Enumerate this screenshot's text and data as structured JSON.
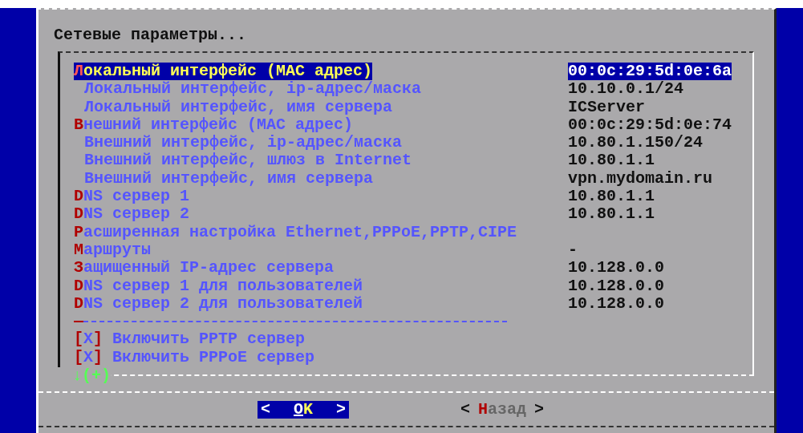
{
  "dialog": {
    "title": "Сетевые параметры...",
    "items": [
      {
        "kind": "main",
        "label": "Локальный интерфейс (MAC адрес)",
        "value": "00:0c:29:5d:0e:6a",
        "selected": true
      },
      {
        "kind": "sub",
        "label": "Локальный интерфейс, ip-адрес/маска",
        "value": "10.10.0.1/24",
        "selected": false
      },
      {
        "kind": "sub",
        "label": "Локальный интерфейс, имя сервера",
        "value": "ICServer",
        "selected": false
      },
      {
        "kind": "main",
        "label": "Внешний интерфейс (MAC адрес)",
        "value": "00:0c:29:5d:0e:74",
        "selected": false
      },
      {
        "kind": "sub",
        "label": "Внешний интерфейс, ip-адрес/маска",
        "value": "10.80.1.150/24",
        "selected": false
      },
      {
        "kind": "sub",
        "label": "Внешний интерфейс, шлюз в Internet",
        "value": "10.80.1.1",
        "selected": false
      },
      {
        "kind": "sub",
        "label": "Внешний интерфейс, имя сервера",
        "value": "vpn.mydomain.ru",
        "selected": false
      },
      {
        "kind": "main",
        "label": "DNS сервер 1",
        "value": "10.80.1.1",
        "selected": false
      },
      {
        "kind": "main",
        "label": "DNS сервер 2",
        "value": "10.80.1.1",
        "selected": false
      },
      {
        "kind": "main",
        "label": "Расширенная настройка Ethernet,PPPoE,PPTP,CIPE",
        "selected": false
      },
      {
        "kind": "main",
        "label": "Маршруты",
        "value": "-",
        "selected": false
      },
      {
        "kind": "main",
        "label": "Защищенный IP-адрес сервера",
        "value": "10.128.0.0",
        "selected": false
      },
      {
        "kind": "main",
        "label": "DNS сервер 1 для пользователей",
        "value": "10.128.0.0",
        "selected": false
      },
      {
        "kind": "main",
        "label": "DNS сервер 2 для пользователей",
        "value": "10.128.0.0",
        "selected": false
      },
      {
        "kind": "separator"
      },
      {
        "kind": "checkbox",
        "box": "[X]",
        "label": "Включить PPTP сервер",
        "selected": false
      },
      {
        "kind": "checkbox",
        "box": "[X]",
        "label": "Включить PPPoE сервер",
        "selected": false
      }
    ],
    "scroll_indicator": "↓(+)",
    "buttons": [
      {
        "open": "<",
        "label": "OK",
        "close": ">",
        "selected": true
      },
      {
        "open": "<",
        "label": "Назад",
        "close": ">",
        "selected": false
      }
    ]
  }
}
